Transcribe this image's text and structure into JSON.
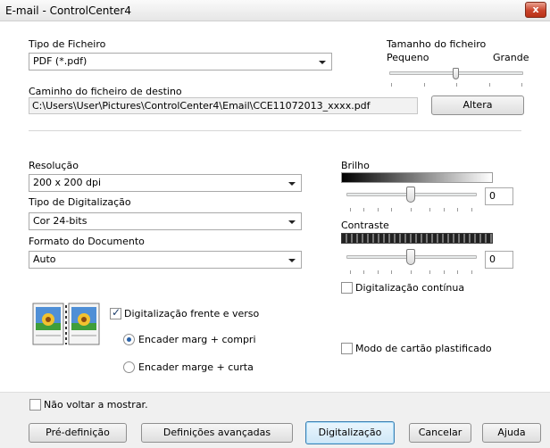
{
  "window": {
    "title": "E-mail - ControlCenter4",
    "close_label": "x"
  },
  "file_type": {
    "label": "Tipo de Ficheiro",
    "value": "PDF (*.pdf)"
  },
  "file_size": {
    "label": "Tamanho do ficheiro",
    "min_label": "Pequeno",
    "max_label": "Grande",
    "level": 0.5
  },
  "destination": {
    "label": "Caminho do ficheiro de destino",
    "value": "C:\\Users\\User\\Pictures\\ControlCenter4\\Email\\CCE11072013_xxxx.pdf",
    "change_button": "Altera"
  },
  "resolution": {
    "label": "Resolução",
    "value": "200 x 200 dpi"
  },
  "scan_type": {
    "label": "Tipo de Digitalização",
    "value": "Cor 24-bits"
  },
  "document_format": {
    "label": "Formato do Documento",
    "value": "Auto"
  },
  "brightness": {
    "label": "Brilho",
    "value": "0"
  },
  "contrast": {
    "label": "Contraste",
    "value": "0"
  },
  "continuous_scan": {
    "label": "Digitalização contínua",
    "checked": false
  },
  "duplex": {
    "label": "Digitalização frente e verso",
    "checked": true,
    "option_long": "Encader marg + compri",
    "option_short": "Encader marge + curta",
    "selected": "long"
  },
  "plastic_card": {
    "label": "Modo de cartão plastificado",
    "checked": false
  },
  "dont_show": {
    "label": "Não voltar a mostrar.",
    "checked": false
  },
  "buttons": {
    "preset": "Pré-definição",
    "advanced": "Definições avançadas",
    "scan": "Digitalização",
    "cancel": "Cancelar",
    "help": "Ajuda"
  },
  "icons": {
    "duplex_preview": "duplex-book-icon",
    "dropdown": "chevron-down-icon",
    "close": "close-icon"
  }
}
